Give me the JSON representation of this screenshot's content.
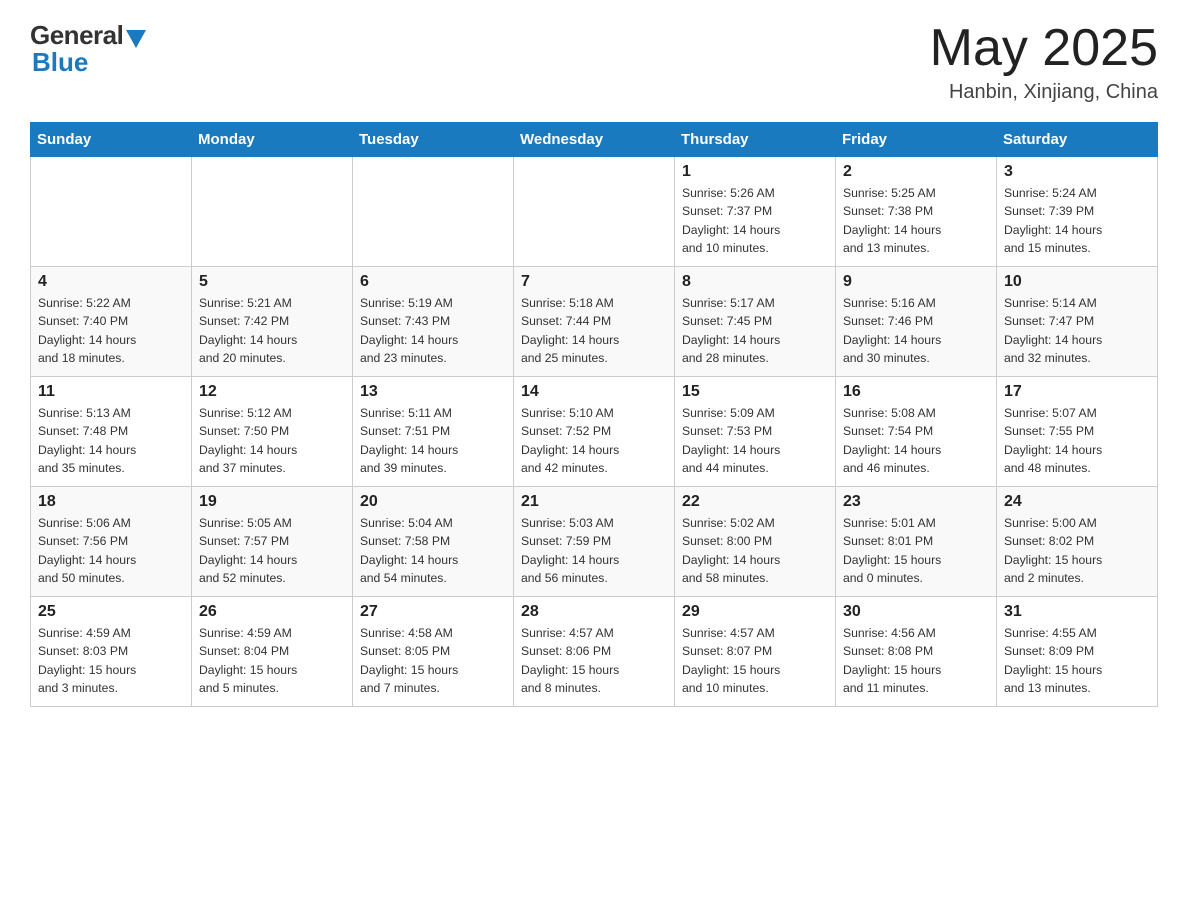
{
  "header": {
    "logo_general": "General",
    "logo_blue": "Blue",
    "month_title": "May 2025",
    "location": "Hanbin, Xinjiang, China"
  },
  "days_of_week": [
    "Sunday",
    "Monday",
    "Tuesday",
    "Wednesday",
    "Thursday",
    "Friday",
    "Saturday"
  ],
  "weeks": [
    [
      {
        "day": "",
        "info": ""
      },
      {
        "day": "",
        "info": ""
      },
      {
        "day": "",
        "info": ""
      },
      {
        "day": "",
        "info": ""
      },
      {
        "day": "1",
        "info": "Sunrise: 5:26 AM\nSunset: 7:37 PM\nDaylight: 14 hours\nand 10 minutes."
      },
      {
        "day": "2",
        "info": "Sunrise: 5:25 AM\nSunset: 7:38 PM\nDaylight: 14 hours\nand 13 minutes."
      },
      {
        "day": "3",
        "info": "Sunrise: 5:24 AM\nSunset: 7:39 PM\nDaylight: 14 hours\nand 15 minutes."
      }
    ],
    [
      {
        "day": "4",
        "info": "Sunrise: 5:22 AM\nSunset: 7:40 PM\nDaylight: 14 hours\nand 18 minutes."
      },
      {
        "day": "5",
        "info": "Sunrise: 5:21 AM\nSunset: 7:42 PM\nDaylight: 14 hours\nand 20 minutes."
      },
      {
        "day": "6",
        "info": "Sunrise: 5:19 AM\nSunset: 7:43 PM\nDaylight: 14 hours\nand 23 minutes."
      },
      {
        "day": "7",
        "info": "Sunrise: 5:18 AM\nSunset: 7:44 PM\nDaylight: 14 hours\nand 25 minutes."
      },
      {
        "day": "8",
        "info": "Sunrise: 5:17 AM\nSunset: 7:45 PM\nDaylight: 14 hours\nand 28 minutes."
      },
      {
        "day": "9",
        "info": "Sunrise: 5:16 AM\nSunset: 7:46 PM\nDaylight: 14 hours\nand 30 minutes."
      },
      {
        "day": "10",
        "info": "Sunrise: 5:14 AM\nSunset: 7:47 PM\nDaylight: 14 hours\nand 32 minutes."
      }
    ],
    [
      {
        "day": "11",
        "info": "Sunrise: 5:13 AM\nSunset: 7:48 PM\nDaylight: 14 hours\nand 35 minutes."
      },
      {
        "day": "12",
        "info": "Sunrise: 5:12 AM\nSunset: 7:50 PM\nDaylight: 14 hours\nand 37 minutes."
      },
      {
        "day": "13",
        "info": "Sunrise: 5:11 AM\nSunset: 7:51 PM\nDaylight: 14 hours\nand 39 minutes."
      },
      {
        "day": "14",
        "info": "Sunrise: 5:10 AM\nSunset: 7:52 PM\nDaylight: 14 hours\nand 42 minutes."
      },
      {
        "day": "15",
        "info": "Sunrise: 5:09 AM\nSunset: 7:53 PM\nDaylight: 14 hours\nand 44 minutes."
      },
      {
        "day": "16",
        "info": "Sunrise: 5:08 AM\nSunset: 7:54 PM\nDaylight: 14 hours\nand 46 minutes."
      },
      {
        "day": "17",
        "info": "Sunrise: 5:07 AM\nSunset: 7:55 PM\nDaylight: 14 hours\nand 48 minutes."
      }
    ],
    [
      {
        "day": "18",
        "info": "Sunrise: 5:06 AM\nSunset: 7:56 PM\nDaylight: 14 hours\nand 50 minutes."
      },
      {
        "day": "19",
        "info": "Sunrise: 5:05 AM\nSunset: 7:57 PM\nDaylight: 14 hours\nand 52 minutes."
      },
      {
        "day": "20",
        "info": "Sunrise: 5:04 AM\nSunset: 7:58 PM\nDaylight: 14 hours\nand 54 minutes."
      },
      {
        "day": "21",
        "info": "Sunrise: 5:03 AM\nSunset: 7:59 PM\nDaylight: 14 hours\nand 56 minutes."
      },
      {
        "day": "22",
        "info": "Sunrise: 5:02 AM\nSunset: 8:00 PM\nDaylight: 14 hours\nand 58 minutes."
      },
      {
        "day": "23",
        "info": "Sunrise: 5:01 AM\nSunset: 8:01 PM\nDaylight: 15 hours\nand 0 minutes."
      },
      {
        "day": "24",
        "info": "Sunrise: 5:00 AM\nSunset: 8:02 PM\nDaylight: 15 hours\nand 2 minutes."
      }
    ],
    [
      {
        "day": "25",
        "info": "Sunrise: 4:59 AM\nSunset: 8:03 PM\nDaylight: 15 hours\nand 3 minutes."
      },
      {
        "day": "26",
        "info": "Sunrise: 4:59 AM\nSunset: 8:04 PM\nDaylight: 15 hours\nand 5 minutes."
      },
      {
        "day": "27",
        "info": "Sunrise: 4:58 AM\nSunset: 8:05 PM\nDaylight: 15 hours\nand 7 minutes."
      },
      {
        "day": "28",
        "info": "Sunrise: 4:57 AM\nSunset: 8:06 PM\nDaylight: 15 hours\nand 8 minutes."
      },
      {
        "day": "29",
        "info": "Sunrise: 4:57 AM\nSunset: 8:07 PM\nDaylight: 15 hours\nand 10 minutes."
      },
      {
        "day": "30",
        "info": "Sunrise: 4:56 AM\nSunset: 8:08 PM\nDaylight: 15 hours\nand 11 minutes."
      },
      {
        "day": "31",
        "info": "Sunrise: 4:55 AM\nSunset: 8:09 PM\nDaylight: 15 hours\nand 13 minutes."
      }
    ]
  ]
}
